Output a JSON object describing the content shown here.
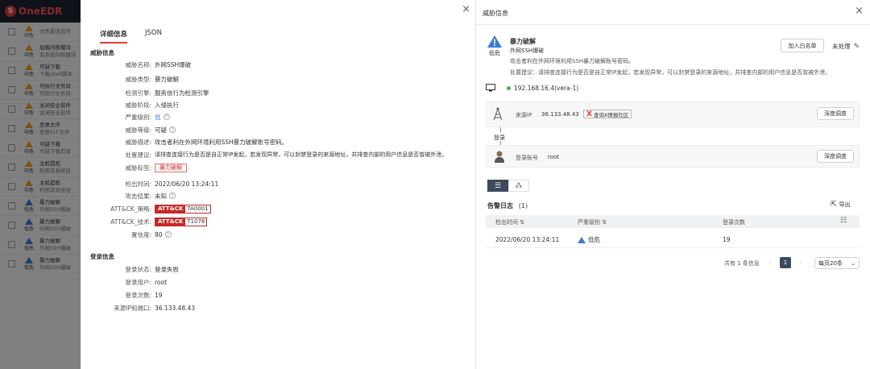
{
  "brand": {
    "logo_text": "OneEDR",
    "accent": "#e53935"
  },
  "bg_list": {
    "rows": [
      {
        "sev": "中危",
        "title": "",
        "sub": "文件最佳异常",
        "color": "#f0a020"
      },
      {
        "sev": "中危",
        "title": "加载内核模块",
        "sub": "非系统内核模块",
        "color": "#f0a020"
      },
      {
        "sev": "中危",
        "title": "可疑下载",
        "sub": "下载shell脚本",
        "color": "#f0a020"
      },
      {
        "sev": "中危",
        "title": "可执行文件异",
        "sub": "可执行文件异",
        "color": "#f0a020"
      },
      {
        "sev": "中危",
        "title": "关闭安全软件",
        "sub": "关闭安全软件",
        "color": "#f0a020"
      },
      {
        "sev": "中危",
        "title": "恶意文件",
        "sub": "恶意ELF文件",
        "color": "#f0a020"
      },
      {
        "sev": "中危",
        "title": "可疑下载",
        "sub": "可疑下载有害",
        "color": "#f0a020"
      },
      {
        "sev": "中危",
        "title": "主机提权",
        "sub": "利用非系统自",
        "color": "#f0a020"
      },
      {
        "sev": "中危",
        "title": "主机提权",
        "sub": "利用非系统自",
        "color": "#f0a020"
      },
      {
        "sev": "低危",
        "title": "暴力破解",
        "sub": "外网SSH爆破",
        "color": "#3a7bd5"
      },
      {
        "sev": "低危",
        "title": "暴力破解",
        "sub": "外网SSH爆破",
        "color": "#3a7bd5"
      },
      {
        "sev": "低危",
        "title": "暴力破解",
        "sub": "外网SSH爆破",
        "color": "#3a7bd5"
      },
      {
        "sev": "低危",
        "title": "暴力破解",
        "sub": "外网SSH爆破",
        "color": "#3a7bd5"
      }
    ]
  },
  "detail": {
    "close_icon": "×",
    "tabs": [
      {
        "label": "详细信息"
      },
      {
        "label": "JSON"
      }
    ],
    "threat_section": "威胁信息",
    "fields": {
      "name_k": "威胁名称:",
      "name_v": "外网SSH爆破",
      "type_k": "威胁类型:",
      "type_v": "暴力破解",
      "engine_k": "检测引擎:",
      "engine_v": "服务信行为检测引擎",
      "stage_k": "威胁阶段:",
      "stage_v": "入侵执行",
      "severity_k": "严重级别:",
      "severity_v": "低",
      "level_k": "威胁等级:",
      "level_v": "可疑",
      "desc_k": "威胁描述:",
      "desc_v": "攻击者利在外网环境利用SSH暴力破解账号密码。",
      "advice_k": "处置建议:",
      "advice_v": "请排查连接行为是否是自正常IP发起，若发现异常，可以封禁登录的来源地址，并排查内部的用户信息是否曾被外泄。",
      "tag_k": "威胁标签:",
      "tag_v": "暴力破解",
      "time_k": "检出时间:",
      "time_v": "2022/06/20 13:24:11",
      "result_k": "攻击结果:",
      "result_v": "未知",
      "tactic_k": "ATT&CK_策略:",
      "tactic_badge": "ATT&CK",
      "tactic_v": "TA0001",
      "tech_k": "ATT&CK_技术:",
      "tech_badge": "ATT&CK",
      "tech_v": "T1078",
      "conf_k": "置信度:",
      "conf_v": "80"
    },
    "login_section": "登录信息",
    "login": {
      "status_k": "登录状态:",
      "status_v": "登录失败",
      "user_k": "登录用户:",
      "user_v": "root",
      "count_k": "登录次数:",
      "count_v": "19",
      "src_k": "来源IP和端口:",
      "src_v": "36.133.48.43"
    }
  },
  "threat": {
    "title": "威胁信息",
    "close_icon": "×",
    "sev_label": "低危",
    "name": "暴力破解",
    "subname": "外网SSH爆破",
    "desc": "攻击者利在外网环境利用SSH暴力破解账号密码。",
    "advice_k": "处置建议：",
    "advice_v": "请排查连接行为是否是自正常IP发起，若发现异常，可以封禁登录的来源地址，并排查内部的用户信息是否曾被外泄。",
    "whitelist_btn": "加入白名单",
    "status": "未处理",
    "host": "192.168.16.4(vera-1)",
    "src_ip_k": "来源IP",
    "src_ip_v": "36.133.48.43",
    "xthreat": "查询X情报社区",
    "deep_btn": "深度调查",
    "login_label": "登录",
    "account_k": "登录账号",
    "account_v": "root",
    "deep_btn2": "深度调查",
    "alert_title": "告警日志",
    "alert_count": "(1)",
    "export": "导出",
    "columns": {
      "time": "检出时间",
      "sev": "严重级别",
      "count": "登录次数"
    },
    "row": {
      "time": "2022/06/20 13:24:11",
      "sev": "低危",
      "count": "19"
    },
    "pager": {
      "total": "共有 1 条信息",
      "page": "1",
      "size": "每页20条"
    }
  }
}
